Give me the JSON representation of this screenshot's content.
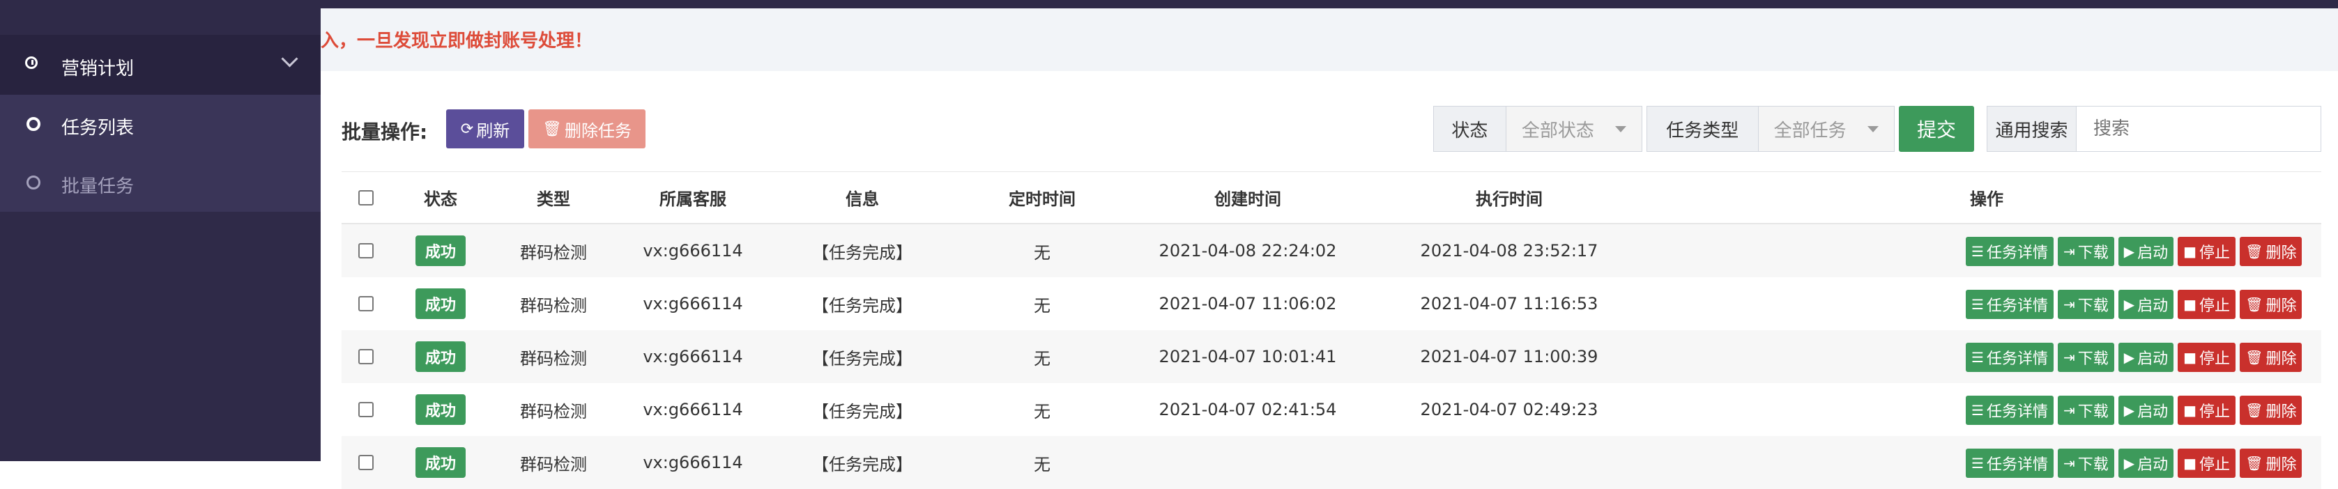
{
  "sidebar": {
    "group_label": "营销计划",
    "items": [
      {
        "label": "任务列表"
      },
      {
        "label": "批量任务"
      }
    ]
  },
  "notice": {
    "text": "入，一旦发现立即做封账号处理！"
  },
  "toolbar": {
    "batch_label": "批量操作:",
    "refresh_label": "刷新",
    "delete_task_label": "删除任务",
    "status_addon": "状态",
    "status_value": "全部状态",
    "type_addon": "任务类型",
    "type_value": "全部任务",
    "submit_label": "提交",
    "search_addon": "通用搜索",
    "search_placeholder": "搜索"
  },
  "table": {
    "headers": [
      "状态",
      "类型",
      "所属客服",
      "信息",
      "定时时间",
      "创建时间",
      "执行时间",
      "操作"
    ],
    "rows": [
      {
        "status": "成功",
        "type": "群码检测",
        "cs": "vx:g666114",
        "info": "【任务完成】",
        "timer": "无",
        "created": "2021-04-08 22:24:02",
        "exec": "2021-04-08 23:52:17"
      },
      {
        "status": "成功",
        "type": "群码检测",
        "cs": "vx:g666114",
        "info": "【任务完成】",
        "timer": "无",
        "created": "2021-04-07 11:06:02",
        "exec": "2021-04-07 11:16:53"
      },
      {
        "status": "成功",
        "type": "群码检测",
        "cs": "vx:g666114",
        "info": "【任务完成】",
        "timer": "无",
        "created": "2021-04-07 10:01:41",
        "exec": "2021-04-07 11:00:39"
      },
      {
        "status": "成功",
        "type": "群码检测",
        "cs": "vx:g666114",
        "info": "【任务完成】",
        "timer": "无",
        "created": "2021-04-07 02:41:54",
        "exec": "2021-04-07 02:49:23"
      },
      {
        "status": "成功",
        "type": "群码检测",
        "cs": "vx:g666114",
        "info": "【任务完成】",
        "timer": "无",
        "created": "",
        "exec": ""
      }
    ],
    "ops": {
      "detail": "任务详情",
      "download": "下载",
      "start": "启动",
      "stop": "停止",
      "delete": "删除"
    }
  },
  "colors": {
    "sidebar_bg": "#2f2a48",
    "primary": "#5b4e9a",
    "success": "#3d9a5b",
    "danger": "#c9302c",
    "warning_text": "#dd4b39"
  }
}
